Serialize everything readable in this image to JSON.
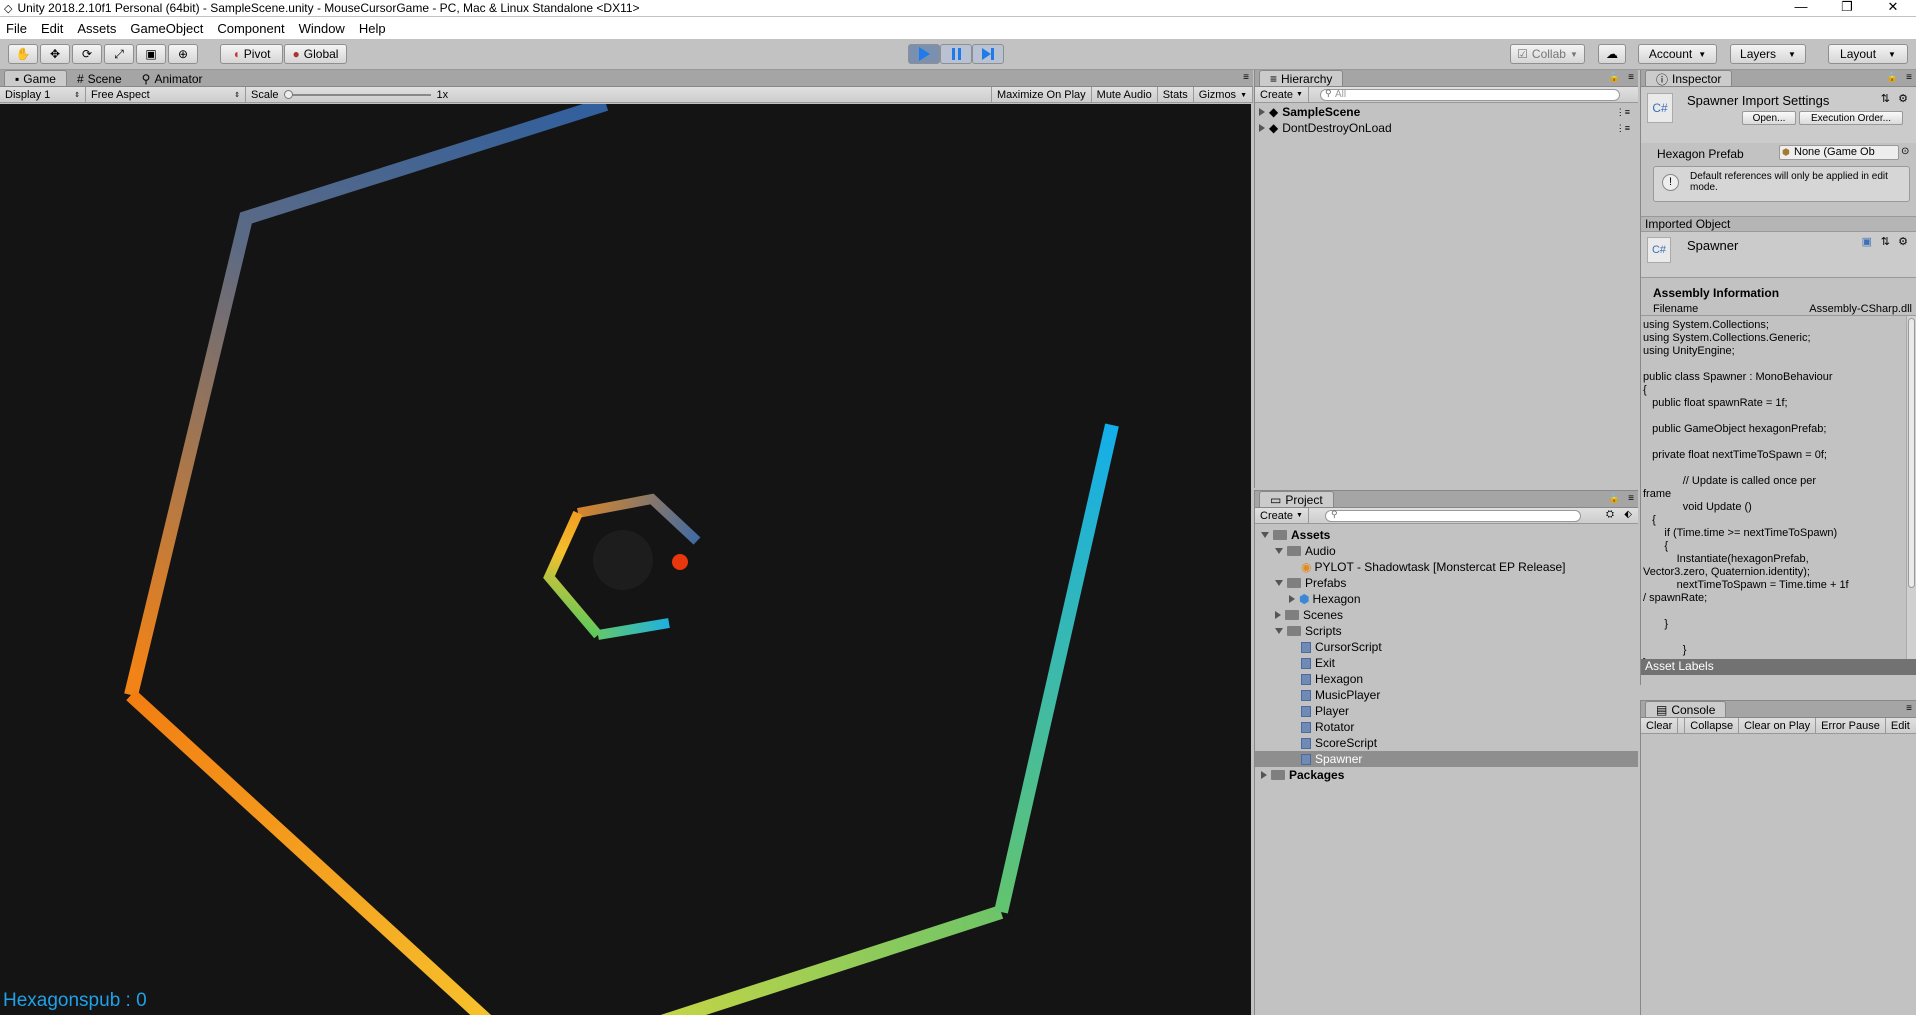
{
  "window": {
    "title": "Unity 2018.2.10f1 Personal (64bit) - SampleScene.unity - MouseCursorGame - PC, Mac & Linux Standalone <DX11>",
    "controls": [
      "—",
      "❐",
      "✕"
    ]
  },
  "menu": [
    "File",
    "Edit",
    "Assets",
    "GameObject",
    "Component",
    "Window",
    "Help"
  ],
  "toolbar": {
    "pivot": "Pivot",
    "global": "Global",
    "collab": "Collab",
    "account": "Account",
    "layers": "Layers",
    "layout": "Layout"
  },
  "game": {
    "tabs": [
      "Game",
      "Scene",
      "Animator"
    ],
    "display": "Display 1",
    "aspect": "Free Aspect",
    "scale_label": "Scale",
    "scale_value": "1x",
    "maximize": "Maximize On Play",
    "mute": "Mute Audio",
    "stats": "Stats",
    "gizmos": "Gizmos",
    "hud": "Hexagonspub : 0"
  },
  "hierarchy": {
    "tab": "Hierarchy",
    "create": "Create",
    "search_placeholder": "All",
    "items": [
      "SampleScene",
      "DontDestroyOnLoad"
    ]
  },
  "project": {
    "tab": "Project",
    "create": "Create",
    "tree": {
      "assets": "Assets",
      "audio": "Audio",
      "audio_file": "PYLOT - Shadowtask [Monstercat EP Release]",
      "prefabs": "Prefabs",
      "hexagon_prefab": "Hexagon",
      "scenes": "Scenes",
      "scripts": "Scripts",
      "script_files": [
        "CursorScript",
        "Exit",
        "Hexagon",
        "MusicPlayer",
        "Player",
        "Rotator",
        "ScoreScript",
        "Spawner"
      ],
      "packages": "Packages"
    }
  },
  "inspector": {
    "tab": "Inspector",
    "title": "Spawner Import Settings",
    "open": "Open...",
    "exec_order": "Execution Order...",
    "field_label": "Hexagon Prefab",
    "field_value": "None (Game Ob",
    "info": "Default references will only be applied in edit mode.",
    "imported_object": "Imported Object",
    "object_name": "Spawner",
    "cs_label": "C#",
    "assembly_header": "Assembly Information",
    "filename_label": "Filename",
    "filename_value": "Assembly-CSharp.dll",
    "code": "using System.Collections;\nusing System.Collections.Generic;\nusing UnityEngine;\n\npublic class Spawner : MonoBehaviour\n{\n   public float spawnRate = 1f;\n\n   public GameObject hexagonPrefab;\n\n   private float nextTimeToSpawn = 0f;\n\n             // Update is called once per\nframe\n             void Update ()\n   {\n       if (Time.time >= nextTimeToSpawn)\n       {\n           Instantiate(hexagonPrefab,\nVector3.zero, Quaternion.identity);\n           nextTimeToSpawn = Time.time + 1f\n/ spawnRate;\n\n       }\n\n             }\n}",
    "asset_labels": "Asset Labels"
  },
  "console": {
    "tab": "Console",
    "buttons": [
      "Clear",
      "Collapse",
      "Clear on Play",
      "Error Pause",
      "Edit"
    ]
  }
}
